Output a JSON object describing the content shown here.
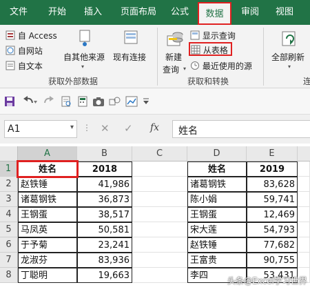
{
  "tabs": [
    {
      "label": "文件",
      "active": false
    },
    {
      "label": "开始",
      "active": false
    },
    {
      "label": "插入",
      "active": false
    },
    {
      "label": "页面布局",
      "active": false
    },
    {
      "label": "公式",
      "active": false
    },
    {
      "label": "数据",
      "active": true
    },
    {
      "label": "审阅",
      "active": false
    },
    {
      "label": "视图",
      "active": false
    }
  ],
  "ribbon": {
    "external": {
      "from_access": "自 Access",
      "from_web": "自网站",
      "from_text": "自文本",
      "other_sources": "自其他来源",
      "existing_connections": "现有连接",
      "group_label": "获取外部数据"
    },
    "transform": {
      "new_query": "新建",
      "new_query_2": "查询",
      "show_queries": "显示查询",
      "from_table": "从表格",
      "recent_sources": "最近使用的源",
      "group_label": "获取和转换"
    },
    "connections": {
      "refresh_all": "全部刷新",
      "group_label_partial": "连"
    }
  },
  "formula_bar": {
    "name_box": "A1",
    "fx": "fx",
    "content": "姓名"
  },
  "columns": [
    "A",
    "B",
    "C",
    "D",
    "E"
  ],
  "rows": [
    "1",
    "2",
    "3",
    "4",
    "5",
    "6",
    "7",
    "8"
  ],
  "table_left": {
    "headers": [
      "姓名",
      "2018"
    ],
    "rows": [
      [
        "赵铁锤",
        "41,986"
      ],
      [
        "诸葛钢铁",
        "36,873"
      ],
      [
        "王钢蛋",
        "38,517"
      ],
      [
        "马凤英",
        "50,581"
      ],
      [
        "于予菊",
        "23,241"
      ],
      [
        "龙淑芬",
        "83,936"
      ],
      [
        "丁聪明",
        "19,663"
      ]
    ]
  },
  "table_right": {
    "headers": [
      "姓名",
      "2019"
    ],
    "rows": [
      [
        "诸葛钢铁",
        "83,628"
      ],
      [
        "陈小娟",
        "59,741"
      ],
      [
        "王钢蛋",
        "12,469"
      ],
      [
        "宋大莲",
        "54,793"
      ],
      [
        "赵铁锤",
        "77,682"
      ],
      [
        "王富贵",
        "90,755"
      ],
      [
        "李四",
        "53,431"
      ]
    ]
  },
  "watermark": "头条@Excel学习世界",
  "colors": {
    "brand_green": "#217346",
    "highlight_red": "#e02020"
  }
}
